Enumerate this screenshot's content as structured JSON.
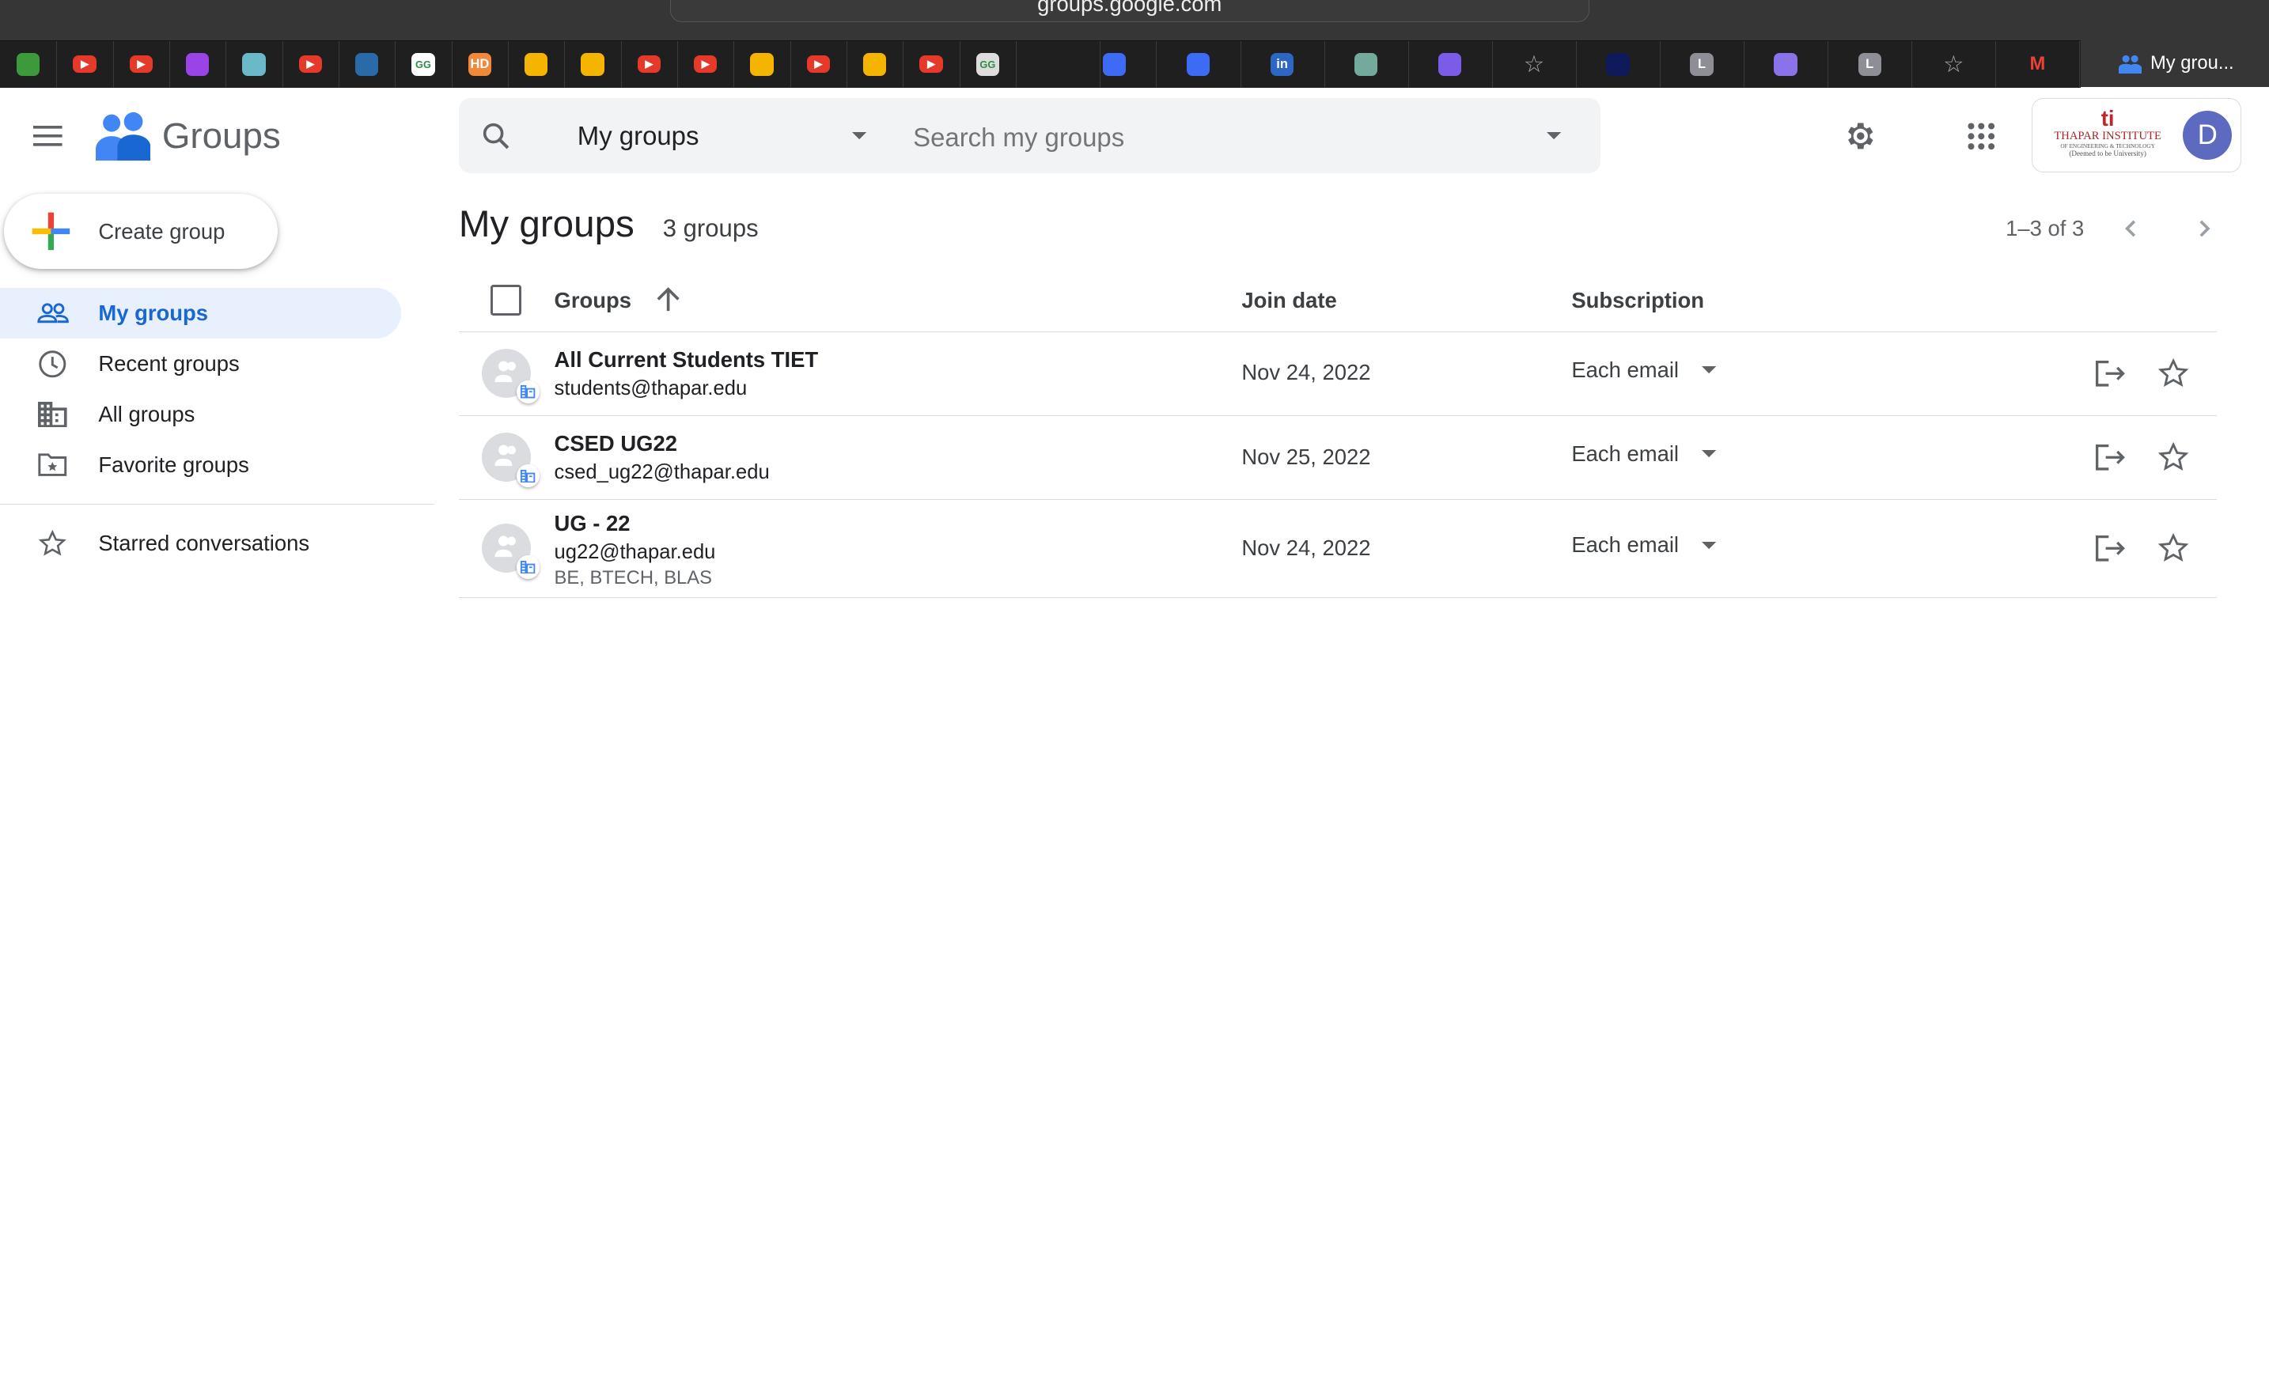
{
  "browser": {
    "url": "groups.google.com",
    "active_tab": "My grou...",
    "bookmarks": [
      {
        "icon": "play-green-icon",
        "color": "#3c9a3c"
      },
      {
        "icon": "youtube-icon",
        "color": "#e53a2a"
      },
      {
        "icon": "youtube-icon",
        "color": "#e53a2a"
      },
      {
        "icon": "u-app-icon",
        "color": "#9a44e8"
      },
      {
        "icon": "mountain-icon",
        "color": "#6bb8c8"
      },
      {
        "icon": "youtube-icon",
        "color": "#e53a2a"
      },
      {
        "icon": "play-blue-icon",
        "color": "#2a6aa8"
      },
      {
        "icon": "geeksforgeeks-icon",
        "color": "#ffffff"
      },
      {
        "icon": "hd-icon",
        "color": "#f08a3a"
      },
      {
        "icon": "google-drive-icon",
        "color": "#f4b400"
      },
      {
        "icon": "google-drive-icon",
        "color": "#f4b400"
      },
      {
        "icon": "youtube-icon",
        "color": "#e53a2a"
      },
      {
        "icon": "youtube-icon",
        "color": "#e53a2a"
      },
      {
        "icon": "google-drive-icon",
        "color": "#f4b400"
      },
      {
        "icon": "youtube-icon",
        "color": "#e53a2a"
      },
      {
        "icon": "google-drive-icon",
        "color": "#f4b400"
      },
      {
        "icon": "youtube-icon",
        "color": "#e53a2a"
      },
      {
        "icon": "geeksforgeeks-icon",
        "color": "#dddddd"
      },
      {
        "icon": "rocket-icon",
        "color": "#1f1f1f"
      },
      {
        "icon": "d-blue-icon",
        "color": "#3d6bf5"
      },
      {
        "icon": "d-blue-icon",
        "color": "#3d6bf5"
      },
      {
        "icon": "linkedin-icon",
        "color": "#2d66c3"
      },
      {
        "icon": "chatgpt-icon",
        "color": "#74aa9c"
      },
      {
        "icon": "bulb-icon",
        "color": "#7b5ce8"
      },
      {
        "icon": "star-icon",
        "color": "#1f1f1f"
      },
      {
        "icon": "dh-icon",
        "color": "#0e1a5a"
      },
      {
        "icon": "l-icon",
        "color": "#8e8e96"
      },
      {
        "icon": "purple-app-icon",
        "color": "#8a72e8"
      },
      {
        "icon": "l-icon",
        "color": "#8e8e96"
      },
      {
        "icon": "star-icon",
        "color": "#1f1f1f"
      },
      {
        "icon": "gmail-icon",
        "color": "#1f1f1f"
      }
    ]
  },
  "header": {
    "app_name": "Groups",
    "search_scope": "My groups",
    "search_placeholder": "Search my groups",
    "org_logo_text": "THAPAR INSTITUTE",
    "org_logo_sub": "OF ENGINEERING & TECHNOLOGY",
    "org_logo_sub2": "(Deemed to be University)",
    "avatar_letter": "D",
    "avatar_color": "#5c6bc0"
  },
  "sidebar": {
    "create_label": "Create group",
    "items": [
      {
        "label": "My groups",
        "icon": "people-icon",
        "active": true
      },
      {
        "label": "Recent groups",
        "icon": "clock-icon"
      },
      {
        "label": "All groups",
        "icon": "building-icon"
      },
      {
        "label": "Favorite groups",
        "icon": "folder-star-icon"
      }
    ],
    "starred_label": "Starred conversations"
  },
  "main": {
    "title": "My groups",
    "count": "3 groups",
    "pagination": "1–3 of 3",
    "columns": {
      "groups": "Groups",
      "join_date": "Join date",
      "subscription": "Subscription"
    },
    "rows": [
      {
        "name": "All Current Students TIET",
        "email": "students@thapar.edu",
        "meta": "",
        "join_date": "Nov 24, 2022",
        "subscription": "Each email"
      },
      {
        "name": "CSED UG22",
        "email": "csed_ug22@thapar.edu",
        "meta": "",
        "join_date": "Nov 25, 2022",
        "subscription": "Each email"
      },
      {
        "name": "UG - 22",
        "email": "ug22@thapar.edu",
        "meta": "BE, BTECH, BLAS",
        "join_date": "Nov 24, 2022",
        "subscription": "Each email"
      }
    ]
  }
}
